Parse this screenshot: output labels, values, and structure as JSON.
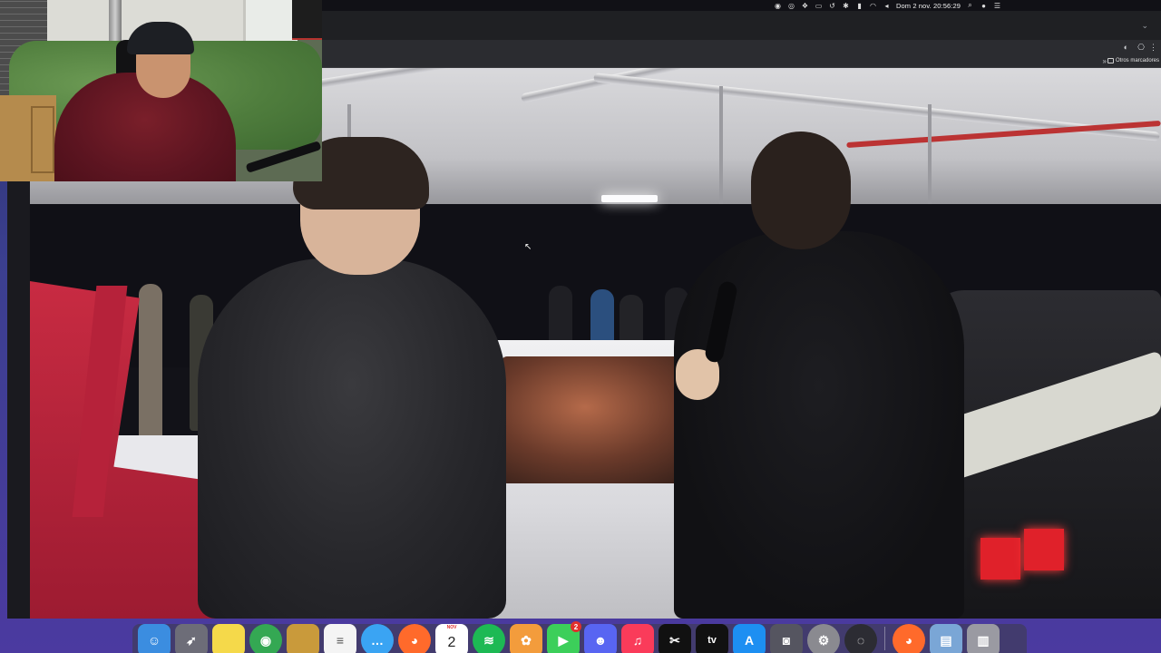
{
  "menubar": {
    "clock": "Dom 2 nov.  20:56:29",
    "status_icons": [
      "creative-cloud-icon",
      "eye-icon",
      "dropbox-icon",
      "screen-icon",
      "timemachine-icon",
      "bluetooth-icon",
      "battery-icon",
      "wifi-icon",
      "volume-icon"
    ],
    "right_icons": [
      "search-icon",
      "siri-icon",
      "control-center-icon"
    ]
  },
  "browser": {
    "bookmarks_folder": "Otros marcadores",
    "bookmarks_more": "»"
  },
  "dock": {
    "calendar_month": "NOV",
    "calendar_day": "2",
    "facetime_badge": "2",
    "appletv_label": "tv",
    "items": [
      {
        "name": "finder",
        "color": "#3b8de0"
      },
      {
        "name": "launchpad",
        "color": "#6d6d78"
      },
      {
        "name": "notes",
        "color": "#f5d94a"
      },
      {
        "name": "chrome",
        "color": "#34a853"
      },
      {
        "name": "folder",
        "color": "#c99a3b"
      },
      {
        "name": "reminders",
        "color": "#f4f4f4"
      },
      {
        "name": "messages",
        "color": "#3aa4f3"
      },
      {
        "name": "firefox",
        "color": "#ff6a2b"
      },
      {
        "name": "calendar",
        "color": "#ffffff"
      },
      {
        "name": "spotify",
        "color": "#1db954"
      },
      {
        "name": "photos",
        "color": "#f39c3c"
      },
      {
        "name": "facetime",
        "color": "#3ccf5a"
      },
      {
        "name": "discord",
        "color": "#5865f2"
      },
      {
        "name": "music",
        "color": "#fa3b5a"
      },
      {
        "name": "capcut",
        "color": "#111111"
      },
      {
        "name": "apple-tv",
        "color": "#111111"
      },
      {
        "name": "app-store",
        "color": "#1d8ff2"
      },
      {
        "name": "screenshot",
        "color": "#555560"
      },
      {
        "name": "system-settings",
        "color": "#8a8a90"
      },
      {
        "name": "obs",
        "color": "#2c2c33"
      },
      {
        "name": "firefox-2",
        "color": "#ff6a2b"
      },
      {
        "name": "preview",
        "color": "#7aa6d6"
      },
      {
        "name": "trash",
        "color": "#9a9aa2"
      }
    ]
  }
}
